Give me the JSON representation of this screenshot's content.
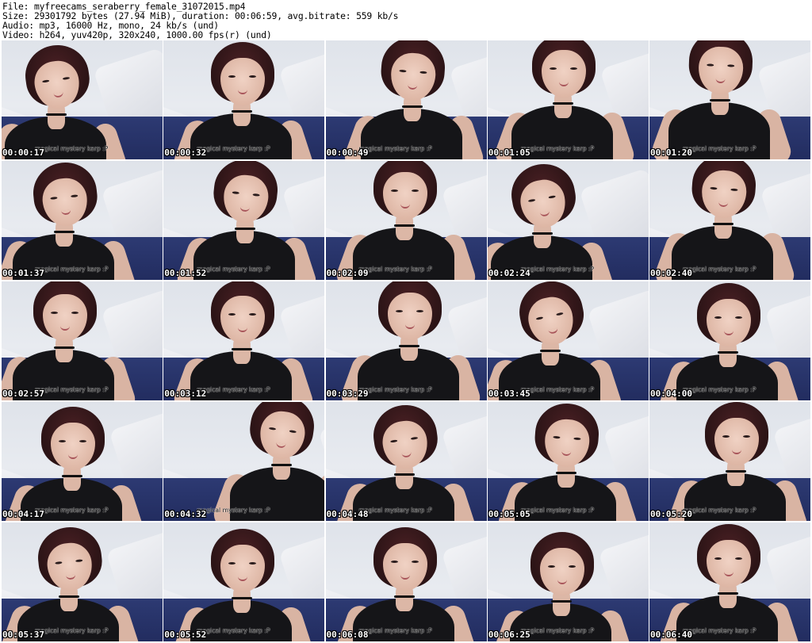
{
  "header": {
    "file_line": "File: myfreecams_seraberry_female_31072015.mp4",
    "size_line": "Size: 29301792 bytes (27.94 MiB), duration: 00:06:59, avg.bitrate: 559 kb/s",
    "audio_line": "Audio: mp3, 16000 Hz, mono, 24 kb/s (und)",
    "video_line": "Video: h264, yuv420p, 320x240, 1000.00 fps(r) (und)"
  },
  "watermark_text": "magical mystery karp :P",
  "thumbnails": [
    {
      "timestamp": "00:00:17"
    },
    {
      "timestamp": "00:00:32"
    },
    {
      "timestamp": "00:00:49"
    },
    {
      "timestamp": "00:01:05"
    },
    {
      "timestamp": "00:01:20"
    },
    {
      "timestamp": "00:01:37"
    },
    {
      "timestamp": "00:01:52"
    },
    {
      "timestamp": "00:02:09"
    },
    {
      "timestamp": "00:02:24"
    },
    {
      "timestamp": "00:02:40"
    },
    {
      "timestamp": "00:02:57"
    },
    {
      "timestamp": "00:03:12"
    },
    {
      "timestamp": "00:03:29"
    },
    {
      "timestamp": "00:03:45"
    },
    {
      "timestamp": "00:04:00"
    },
    {
      "timestamp": "00:04:17"
    },
    {
      "timestamp": "00:04:32"
    },
    {
      "timestamp": "00:04:48"
    },
    {
      "timestamp": "00:05:05"
    },
    {
      "timestamp": "00:05:20"
    },
    {
      "timestamp": "00:05:37"
    },
    {
      "timestamp": "00:05:52"
    },
    {
      "timestamp": "00:06:08"
    },
    {
      "timestamp": "00:06:25"
    },
    {
      "timestamp": "00:06:40"
    }
  ],
  "colors": {
    "background": "#ffffff",
    "text": "#000000",
    "timestamp_text": "#ffffff",
    "blanket": "#2d3a73",
    "shirt": "#151518",
    "hair": "#3a191c"
  }
}
